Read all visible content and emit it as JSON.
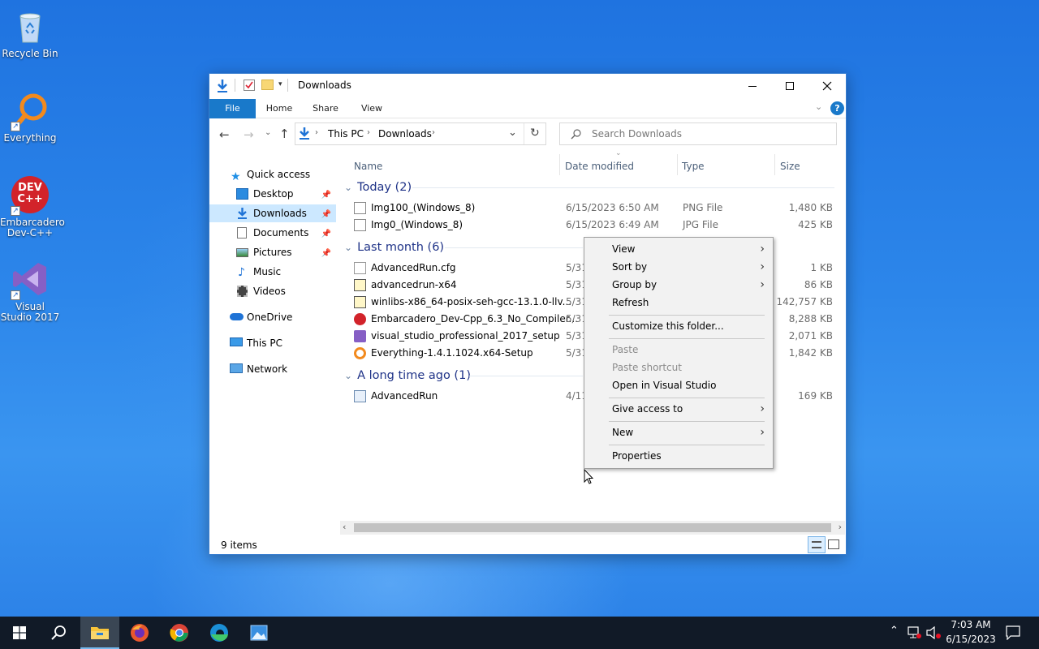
{
  "desktop": {
    "icons": [
      {
        "label": "Recycle Bin"
      },
      {
        "label": "Everything"
      },
      {
        "label": "Embarcadero Dev-C++"
      },
      {
        "label": "Visual Studio 2017"
      }
    ],
    "devcpp_logo_text": "DEV C++"
  },
  "window": {
    "title": "Downloads",
    "ribbon_tabs": [
      "File",
      "Home",
      "Share",
      "View"
    ],
    "address": {
      "segments": [
        "This PC",
        "Downloads"
      ]
    },
    "search": {
      "placeholder": "Search Downloads"
    },
    "nav": [
      {
        "label": "Quick access"
      },
      {
        "label": "Desktop"
      },
      {
        "label": "Downloads"
      },
      {
        "label": "Documents"
      },
      {
        "label": "Pictures"
      },
      {
        "label": "Music"
      },
      {
        "label": "Videos"
      },
      {
        "label": "OneDrive"
      },
      {
        "label": "This PC"
      },
      {
        "label": "Network"
      }
    ],
    "columns": [
      "Name",
      "Date modified",
      "Type",
      "Size"
    ],
    "groups": [
      {
        "title": "Today (2)",
        "rows": [
          {
            "name": "Img100_(Windows_8)",
            "date": "6/15/2023 6:50 AM",
            "type": "PNG File",
            "size": "1,480 KB"
          },
          {
            "name": "Img0_(Windows_8)",
            "date": "6/15/2023 6:49 AM",
            "type": "JPG File",
            "size": "425 KB"
          }
        ]
      },
      {
        "title": "Last month (6)",
        "rows": [
          {
            "name": "AdvancedRun.cfg",
            "date": "5/31",
            "size": "1 KB"
          },
          {
            "name": "advancedrun-x64",
            "date": "5/31",
            "size": "86 KB"
          },
          {
            "name": "winlibs-x86_64-posix-seh-gcc-13.1.0-llv...",
            "date": "5/31",
            "size": "142,757 KB"
          },
          {
            "name": "Embarcadero_Dev-Cpp_6.3_No_Compiler...",
            "date": "5/31",
            "size": "8,288 KB"
          },
          {
            "name": "visual_studio_professional_2017_setup",
            "date": "5/31",
            "size": "2,071 KB"
          },
          {
            "name": "Everything-1.4.1.1024.x64-Setup",
            "date": "5/31",
            "size": "1,842 KB"
          }
        ]
      },
      {
        "title": "A long time ago (1)",
        "rows": [
          {
            "name": "AdvancedRun",
            "date": "4/11",
            "size": "169 KB"
          }
        ]
      }
    ],
    "status": "9 items"
  },
  "context_menu": {
    "items": [
      {
        "label": "View"
      },
      {
        "label": "Sort by"
      },
      {
        "label": "Group by"
      },
      {
        "label": "Refresh"
      },
      {
        "label": "Customize this folder..."
      },
      {
        "label": "Paste"
      },
      {
        "label": "Paste shortcut"
      },
      {
        "label": "Open in Visual Studio"
      },
      {
        "label": "Give access to"
      },
      {
        "label": "New"
      },
      {
        "label": "Properties"
      }
    ]
  },
  "taskbar": {
    "time": "7:03 AM",
    "date": "6/15/2023"
  },
  "colors": {
    "accent": "#1979ca",
    "selection": "#cce8ff",
    "group_header": "#1e3287",
    "taskbar": "#111a27"
  }
}
